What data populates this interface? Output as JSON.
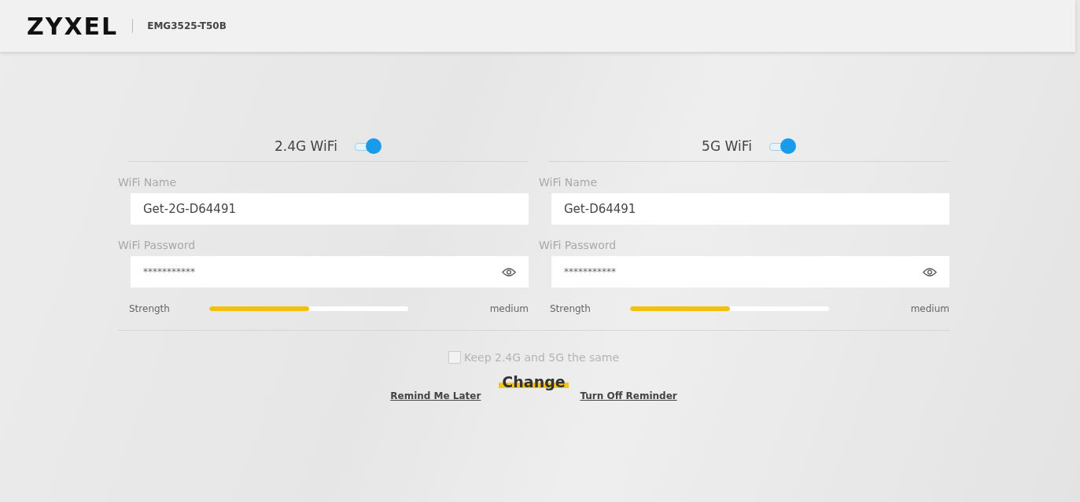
{
  "header": {
    "brand": "ZYXEL",
    "model": "EMG3525-T50B"
  },
  "bands": [
    {
      "title": "2.4G WiFi",
      "enabled": true,
      "name_label": "WiFi Name",
      "name_value": "Get-2G-D64491",
      "password_label": "WiFi Password",
      "password_value": "***********",
      "strength_label": "Strength",
      "level": 0.5,
      "strength_text": "medium"
    },
    {
      "title": "5G WiFi",
      "enabled": true,
      "name_label": "WiFi Name",
      "name_value": "Get-D64491",
      "password_label": "WiFi Password",
      "password_value": "***********",
      "strength_label": "Strength",
      "level": 0.5,
      "strength_text": "medium"
    }
  ],
  "same_option": {
    "label": "Keep 2.4G and 5G the same",
    "checked": false,
    "disabled": true
  },
  "change_button": "Change",
  "links": [
    "Remind Me Later",
    "Turn Off Reminder"
  ]
}
